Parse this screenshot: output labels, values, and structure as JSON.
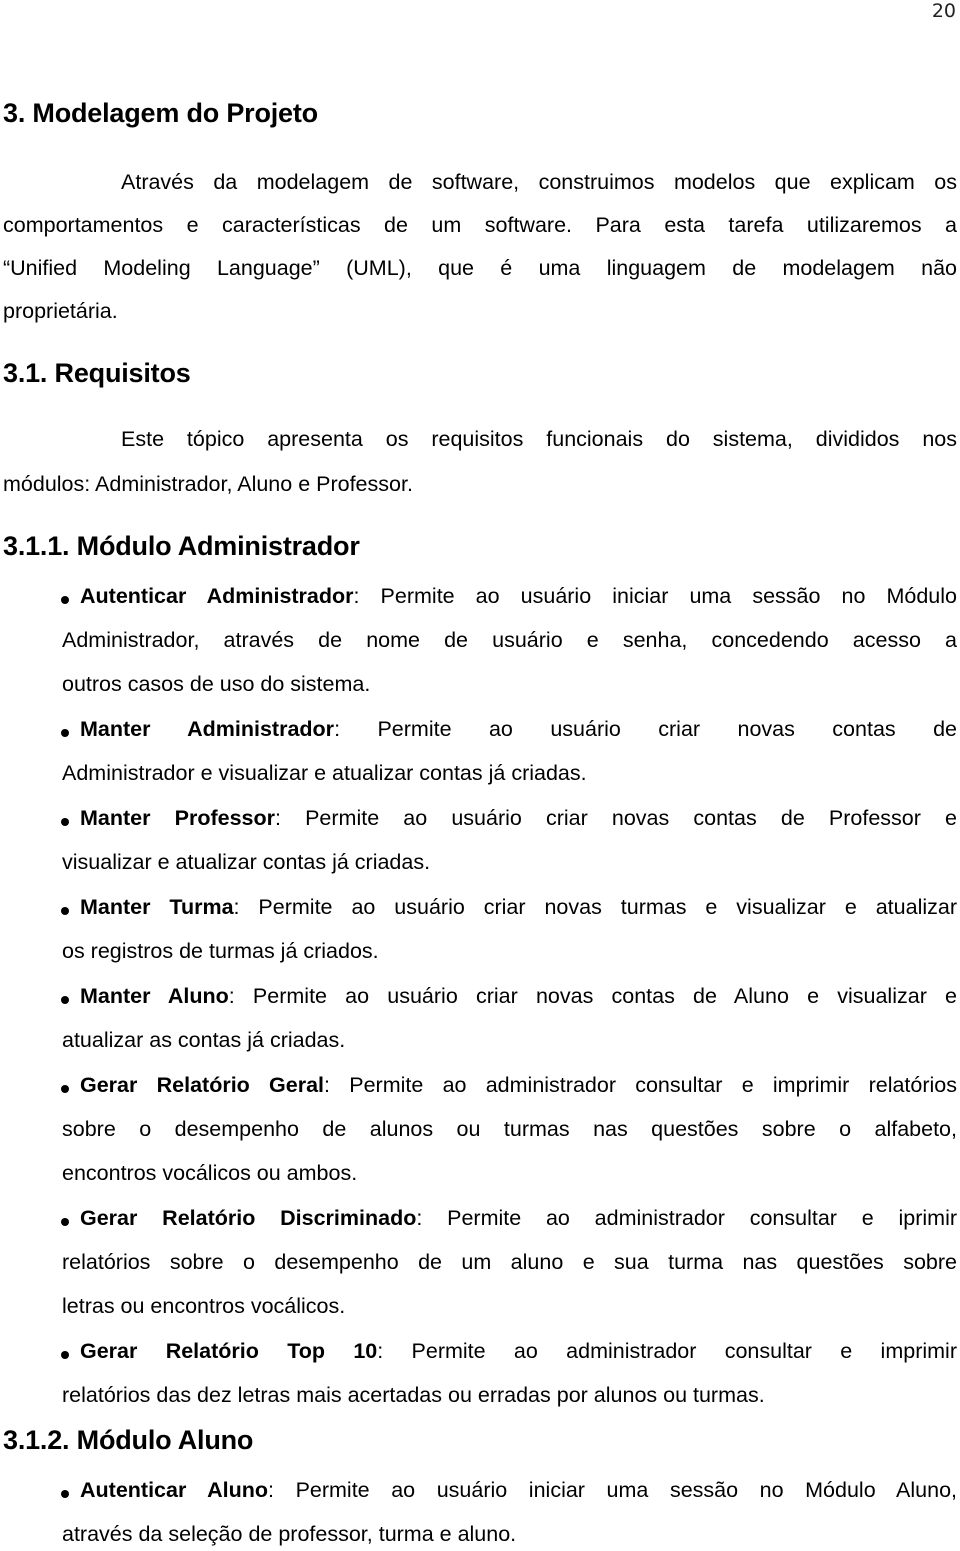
{
  "page_number": "20",
  "section_3": {
    "heading": "3. Modelagem do Projeto",
    "paragraph_lines": [
      "Através da modelagem de software, construimos modelos que explicam os",
      "comportamentos e características de um software. Para esta tarefa utilizaremos a",
      "“Unified Modeling Language” (UML), que é uma linguagem de modelagem não",
      "proprietária."
    ]
  },
  "section_3_1": {
    "heading": "3.1. Requisitos",
    "paragraph_lines": [
      "Este tópico apresenta os requisitos funcionais do sistema, divididos nos",
      "módulos: Administrador, Aluno e Professor."
    ]
  },
  "section_3_1_1": {
    "heading": "3.1.1. Módulo Administrador",
    "items": [
      {
        "term": "Autenticar Administrador",
        "first": ": Permite ao usuário iniciar uma sessão no Módulo",
        "rest": [
          "Administrador, através de nome de usuário e senha, concedendo acesso a",
          "outros casos de uso do sistema."
        ]
      },
      {
        "term": "Manter Administrador",
        "first": ": Permite ao usuário criar novas contas de",
        "rest": [
          "Administrador e visualizar e atualizar contas já criadas."
        ]
      },
      {
        "term": "Manter Professor",
        "first": ": Permite ao usuário criar novas contas de Professor e",
        "rest": [
          "visualizar e atualizar contas já criadas."
        ]
      },
      {
        "term": "Manter Turma",
        "first": ": Permite ao usuário criar novas turmas e visualizar e atualizar",
        "rest": [
          "os registros de turmas já criados."
        ]
      },
      {
        "term": "Manter Aluno",
        "first": ": Permite ao usuário criar novas contas de Aluno e visualizar e",
        "rest": [
          "atualizar as contas já criadas."
        ]
      },
      {
        "term": "Gerar Relatório Geral",
        "first": ": Permite ao administrador consultar e imprimir relatórios",
        "rest": [
          "sobre o desempenho de alunos ou turmas nas questões sobre o alfabeto,",
          "encontros vocálicos ou ambos."
        ]
      },
      {
        "term": "Gerar Relatório Discriminado",
        "first": ": Permite ao administrador consultar e iprimir",
        "rest": [
          "relatórios sobre o desempenho de um aluno e sua turma nas questões sobre",
          "letras ou encontros vocálicos."
        ]
      },
      {
        "term": "Gerar Relatório Top 10",
        "first": ": Permite ao administrador consultar e imprimir",
        "rest": [
          "relatórios das dez letras mais acertadas ou erradas por alunos ou turmas."
        ]
      }
    ]
  },
  "section_3_1_2": {
    "heading": "3.1.2. Módulo Aluno",
    "items": [
      {
        "term": "Autenticar Aluno",
        "first": ": Permite ao usuário iniciar uma sessão no Módulo Aluno,",
        "rest": [
          "através da seleção de professor, turma e aluno."
        ]
      }
    ]
  }
}
